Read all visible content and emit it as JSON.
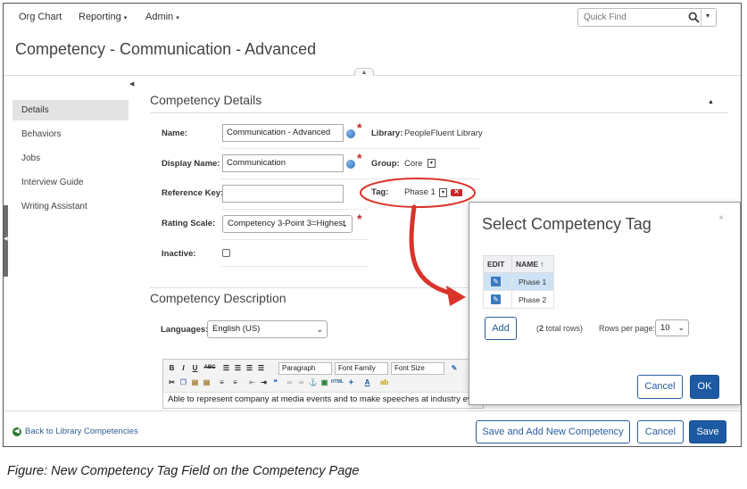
{
  "nav": {
    "org_chart": "Org Chart",
    "reporting": "Reporting",
    "admin": "Admin",
    "quick_find_placeholder": "Quick Find"
  },
  "page_title": "Competency - Communication - Advanced",
  "sidebar": {
    "items": [
      {
        "label": "Details"
      },
      {
        "label": "Behaviors"
      },
      {
        "label": "Jobs"
      },
      {
        "label": "Interview Guide"
      },
      {
        "label": "Writing Assistant"
      }
    ]
  },
  "details": {
    "title": "Competency Details",
    "name_label": "Name:",
    "name_value": "Communication - Advanced",
    "display_name_label": "Display Name:",
    "display_name_value": "Communication",
    "reference_key_label": "Reference Key:",
    "reference_key_value": "",
    "rating_scale_label": "Rating Scale:",
    "rating_scale_value": "Competency 3-Point 3=Highest",
    "inactive_label": "Inactive:",
    "library_label": "Library:",
    "library_value": "PeopleFluent Library",
    "group_label": "Group:",
    "group_value": "Core",
    "tag_label": "Tag:",
    "tag_value": "Phase 1"
  },
  "description": {
    "title": "Competency Description",
    "languages_label": "Languages:",
    "language_value": "English (US)",
    "toolbar": {
      "bold": "B",
      "italic": "I",
      "underline": "U",
      "strike": "ABC",
      "paragraph": "Paragraph",
      "font_family": "Font Family",
      "font_size": "Font Size"
    },
    "text": "Able to represent company at media events and to make speeches at industry events."
  },
  "footer": {
    "back_link": "Back to Library Competencies",
    "save_and_add": "Save and Add New Competency",
    "cancel": "Cancel",
    "save": "Save"
  },
  "modal": {
    "title": "Select Competency Tag",
    "close": "×",
    "col_edit": "EDIT",
    "col_name": "NAME",
    "sort_indicator": "↑",
    "rows": [
      {
        "name": "Phase 1",
        "selected": true
      },
      {
        "name": "Phase 2",
        "selected": false
      }
    ],
    "add": "Add",
    "total_count": "2",
    "total_suffix": " total rows)",
    "total_prefix": "(",
    "rows_per_page_label": "Rows per page:",
    "rows_per_page_value": "10",
    "cancel": "Cancel",
    "ok": "OK"
  },
  "caption": "Figure: New Competency Tag Field on the Competency Page",
  "colors": {
    "primary": "#1d5aa3",
    "annotation_red": "#d9342b",
    "required": "#c62828"
  }
}
